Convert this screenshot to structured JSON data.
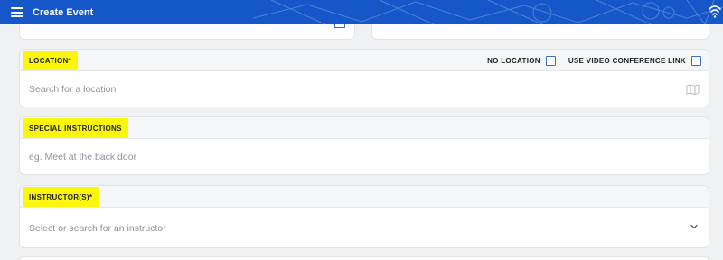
{
  "header": {
    "title": "Create Event",
    "menu_icon": "hamburger-menu-icon",
    "wifi_icon": "wifi-icon",
    "bar_color": "#1557c8"
  },
  "location": {
    "label": "LOCATION*",
    "no_location_label": "NO LOCATION",
    "video_link_label": "USE VIDEO CONFERENCE LINK",
    "placeholder": "Search for a location",
    "icon": "map-icon"
  },
  "special_instructions": {
    "label": "SPECIAL INSTRUCTIONS",
    "placeholder": "eg. Meet at the back door"
  },
  "instructors": {
    "label": "INSTRUCTOR(S)*",
    "placeholder": "Select or search for an instructor",
    "icon": "chevron-down-icon"
  },
  "colors": {
    "highlight": "#fbf60a",
    "checkbox_border": "#3a6fc9"
  }
}
